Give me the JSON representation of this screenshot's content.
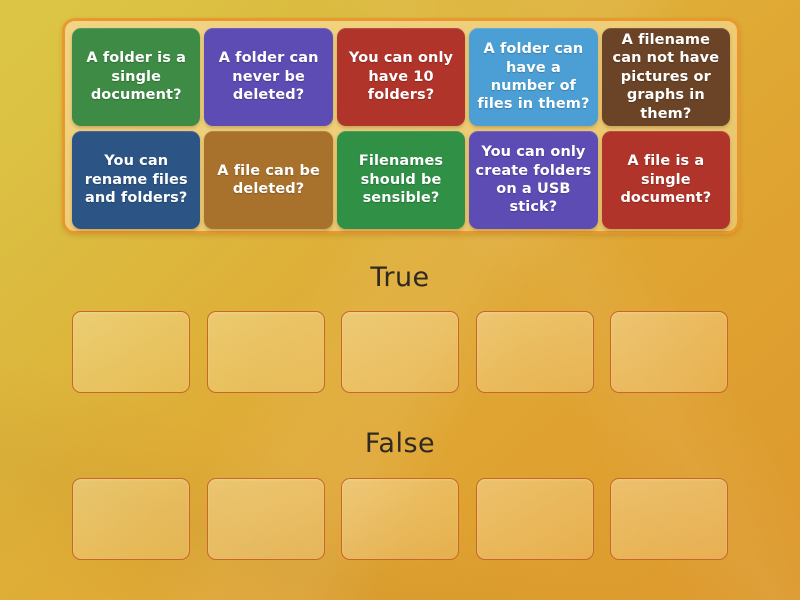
{
  "activity": {
    "type": "true-false-group-sort",
    "tray": {
      "cards": [
        {
          "text": "A folder is a single document?",
          "color": "#3d8b44"
        },
        {
          "text": "A folder can never be deleted?",
          "color": "#5c4cb4"
        },
        {
          "text": "You can only have 10 folders?",
          "color": "#b03429"
        },
        {
          "text": "A folder can have a number of files in them?",
          "color": "#4b9fd5"
        },
        {
          "text": "A filename can not have pictures or graphs in them?",
          "color": "#6b4326"
        },
        {
          "text": "You can rename files and folders?",
          "color": "#2c5585"
        },
        {
          "text": "A file can be deleted?",
          "color": "#a8712c"
        },
        {
          "text": "Filenames should be sensible?",
          "color": "#2f9046"
        },
        {
          "text": "You can only create folders on a USB stick?",
          "color": "#5c4cb4"
        },
        {
          "text": "A file is a single document?",
          "color": "#b03429"
        }
      ]
    },
    "groups": [
      {
        "label": "True",
        "slots": [
          "",
          "",
          "",
          "",
          ""
        ]
      },
      {
        "label": "False",
        "slots": [
          "",
          "",
          "",
          "",
          ""
        ]
      }
    ],
    "theme": {
      "background_start": "#dcc544",
      "background_end": "#dd992e",
      "tray_border": "#e8982c",
      "tray_fill": "#eece78",
      "slot_border": "#c9662a",
      "label_color": "#2e2a22",
      "card_text_color": "#ffffff"
    }
  }
}
